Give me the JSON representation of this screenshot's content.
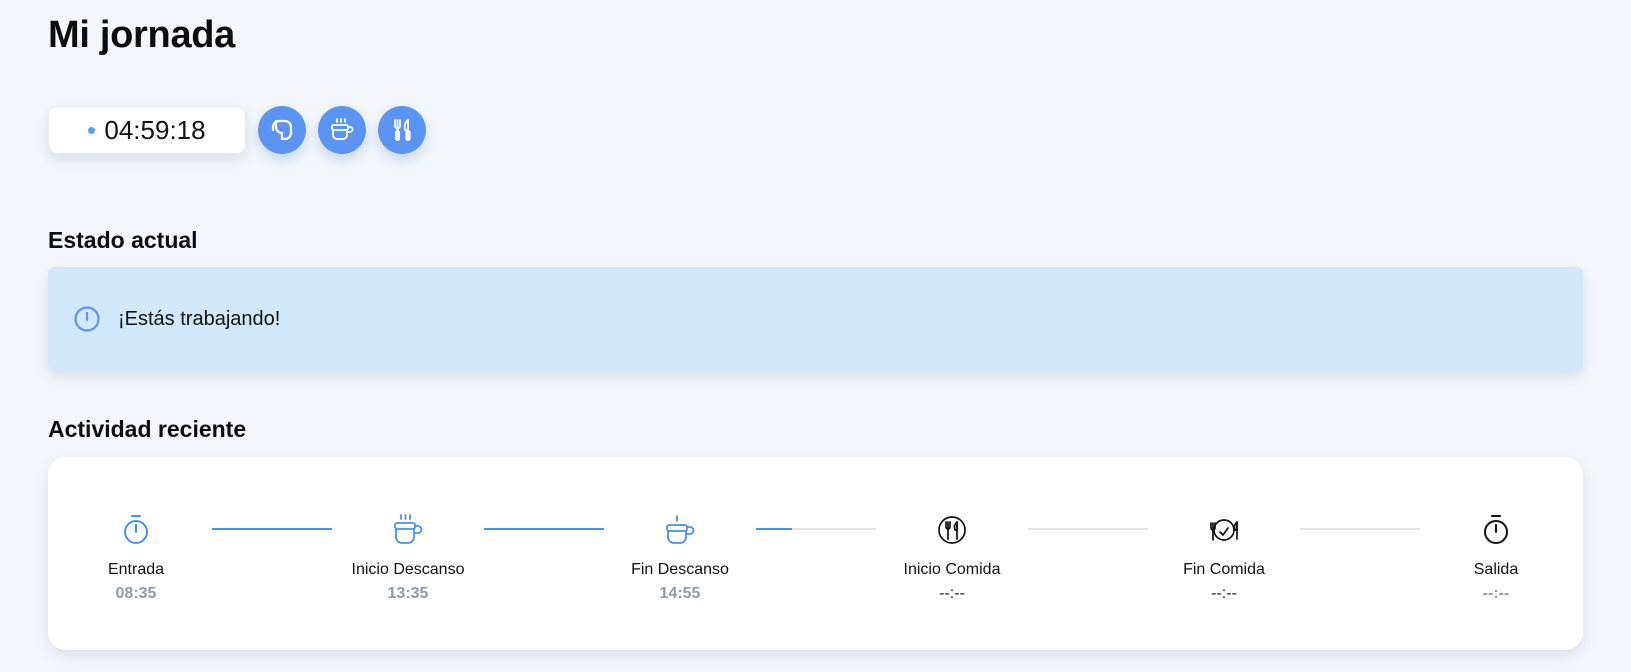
{
  "page": {
    "title": "Mi jornada"
  },
  "timer": {
    "value": "04:59:18"
  },
  "actions": [
    {
      "name": "stop-button",
      "icon": "stop-icon"
    },
    {
      "name": "break-button",
      "icon": "coffee-icon"
    },
    {
      "name": "lunch-button",
      "icon": "utensils-icon"
    }
  ],
  "status": {
    "section_title": "Estado actual",
    "message": "¡Estás trabajando!",
    "icon": "info-circle-icon"
  },
  "activity": {
    "section_title": "Actividad reciente",
    "steps": [
      {
        "label": "Entrada",
        "time": "08:35",
        "icon": "stopwatch-icon",
        "state": "done"
      },
      {
        "label": "Inicio Descanso",
        "time": "13:35",
        "icon": "coffee-steam-icon",
        "state": "done"
      },
      {
        "label": "Fin Descanso",
        "time": "14:55",
        "icon": "coffee-cup-icon",
        "state": "done"
      },
      {
        "label": "Inicio Comida",
        "time": "--:--",
        "icon": "plate-icon",
        "state": "pending"
      },
      {
        "label": "Fin Comida",
        "time": "--:--",
        "icon": "plate-done-icon",
        "state": "pending"
      },
      {
        "label": "Salida",
        "time": "--:--",
        "icon": "stopwatch-icon",
        "state": "future"
      }
    ],
    "progress": [
      1,
      1,
      0.3,
      0,
      0
    ]
  },
  "colors": {
    "accent": "#5b94f2",
    "alert_bg": "#d1e9fb",
    "done": "#4a90e8",
    "muted": "#8e9aae"
  }
}
